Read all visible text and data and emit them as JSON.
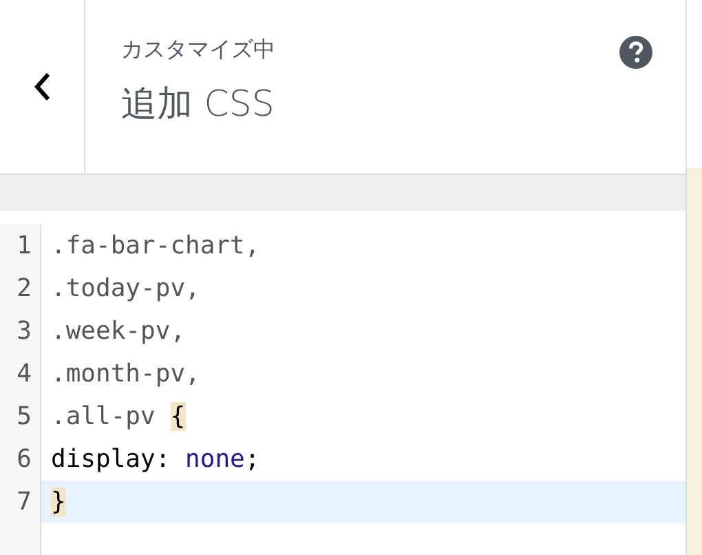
{
  "header": {
    "subtitle": "カスタマイズ中",
    "title": "追加 CSS"
  },
  "editor": {
    "lines": [
      {
        "number": "1",
        "selected": false,
        "tokens": [
          {
            "text": ".fa-bar-chart,",
            "kind": "selector"
          }
        ]
      },
      {
        "number": "2",
        "selected": false,
        "tokens": [
          {
            "text": ".today-pv,",
            "kind": "selector"
          }
        ]
      },
      {
        "number": "3",
        "selected": false,
        "tokens": [
          {
            "text": ".week-pv,",
            "kind": "selector"
          }
        ]
      },
      {
        "number": "4",
        "selected": false,
        "tokens": [
          {
            "text": ".month-pv,",
            "kind": "selector"
          }
        ]
      },
      {
        "number": "5",
        "selected": false,
        "tokens": [
          {
            "text": ".all-pv ",
            "kind": "selector"
          },
          {
            "text": "{",
            "kind": "matched-bracket"
          }
        ]
      },
      {
        "number": "6",
        "selected": false,
        "tokens": [
          {
            "text": "display",
            "kind": "property"
          },
          {
            "text": ": ",
            "kind": "punctuation"
          },
          {
            "text": "none",
            "kind": "value"
          },
          {
            "text": ";",
            "kind": "punctuation"
          }
        ]
      },
      {
        "number": "7",
        "selected": true,
        "tokens": [
          {
            "text": "}",
            "kind": "matched-bracket"
          }
        ]
      }
    ]
  }
}
